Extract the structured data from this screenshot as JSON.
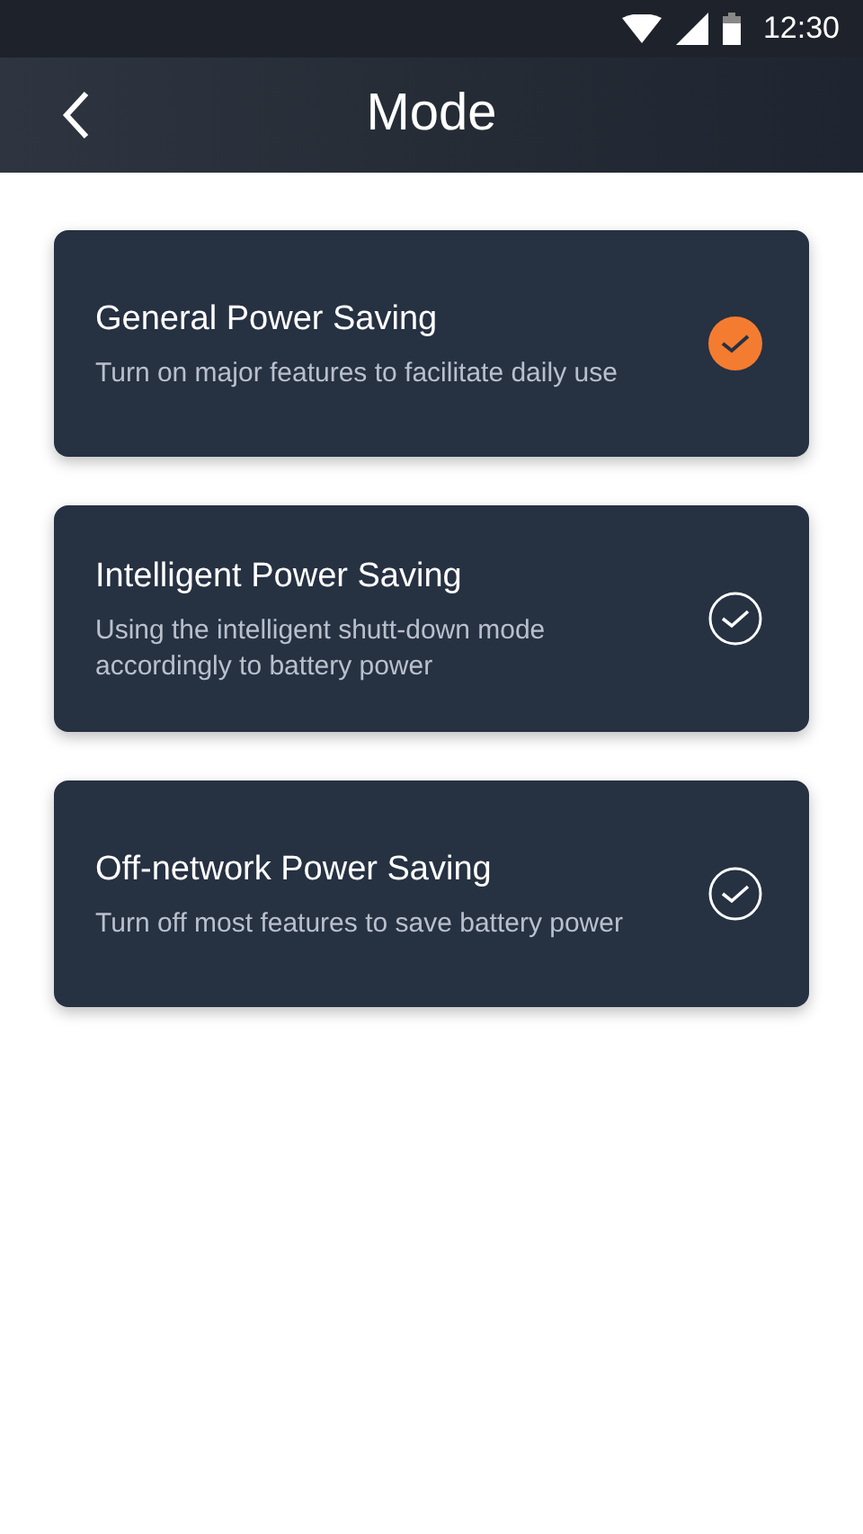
{
  "status_bar": {
    "time": "12:30"
  },
  "header": {
    "title": "Mode"
  },
  "modes": [
    {
      "title": "General Power Saving",
      "description": "Turn on major features to facilitate daily use",
      "selected": true
    },
    {
      "title": "Intelligent Power Saving",
      "description": "Using the intelligent shutt-down mode accordingly to battery power",
      "selected": false
    },
    {
      "title": "Off-network Power Saving",
      "description": "Turn off most features to save battery power",
      "selected": false
    }
  ]
}
